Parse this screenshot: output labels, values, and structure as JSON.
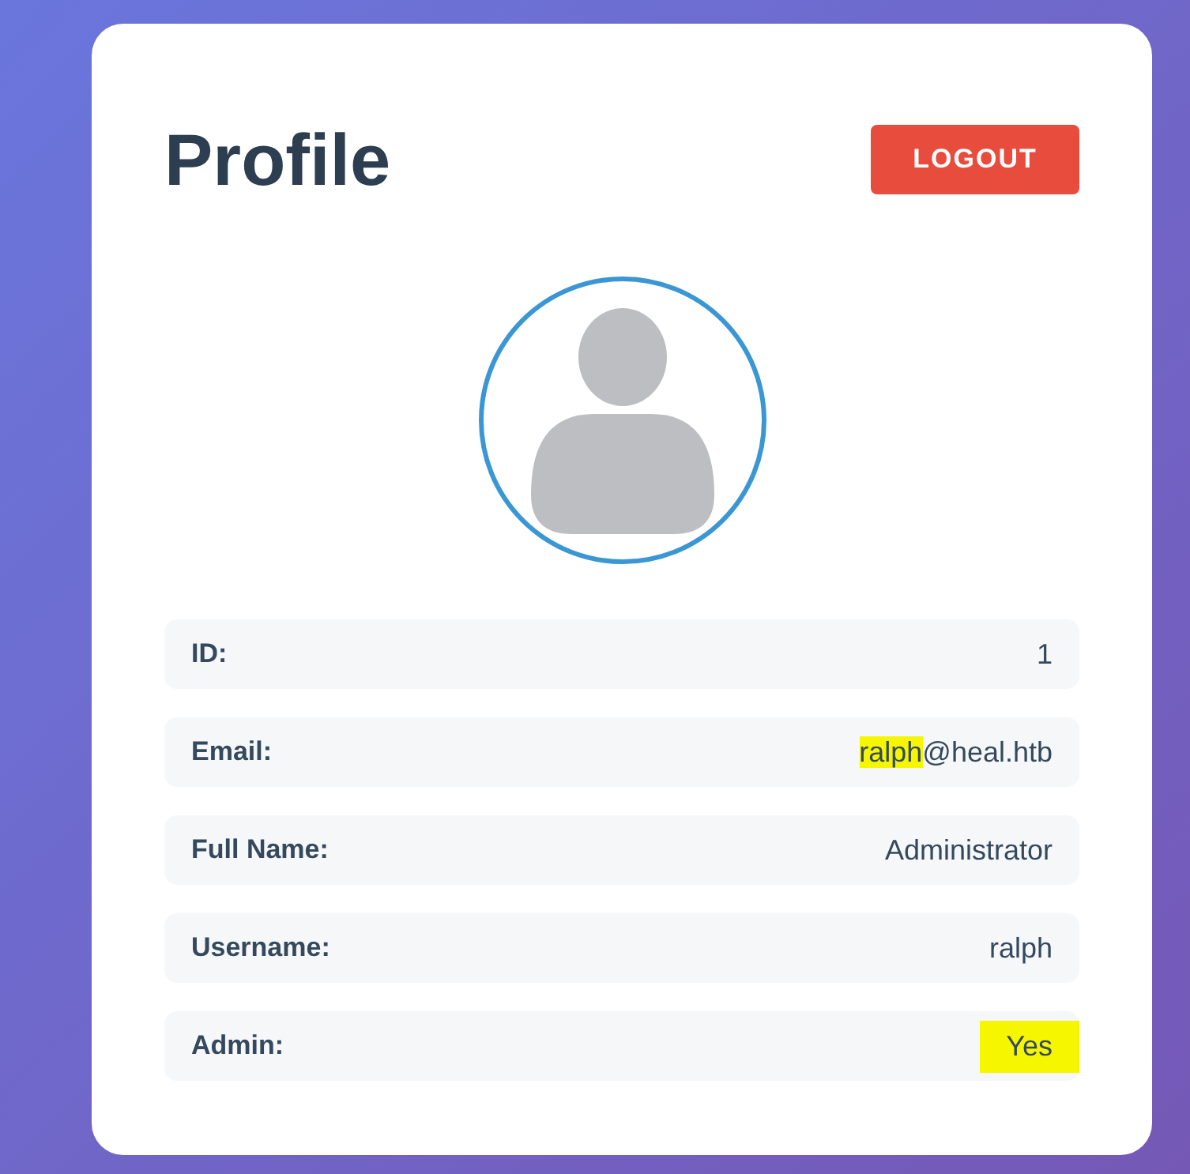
{
  "title": "Profile",
  "logout_button": "LOGOUT",
  "avatar": {
    "kind": "silhouette"
  },
  "fields": [
    {
      "label": "ID:",
      "value_parts": [
        {
          "text": "1",
          "highlighted": false
        }
      ]
    },
    {
      "label": "Email:",
      "value_parts": [
        {
          "text": "ralph",
          "highlighted": true
        },
        {
          "text": "@heal.htb",
          "highlighted": false
        }
      ]
    },
    {
      "label": "Full Name:",
      "value_parts": [
        {
          "text": "Administrator",
          "highlighted": false
        }
      ]
    },
    {
      "label": "Username:",
      "value_parts": [
        {
          "text": "ralph",
          "highlighted": false
        }
      ]
    },
    {
      "label": "Admin:",
      "value_parts": [
        {
          "text": "Yes",
          "highlighted": true
        }
      ]
    }
  ]
}
